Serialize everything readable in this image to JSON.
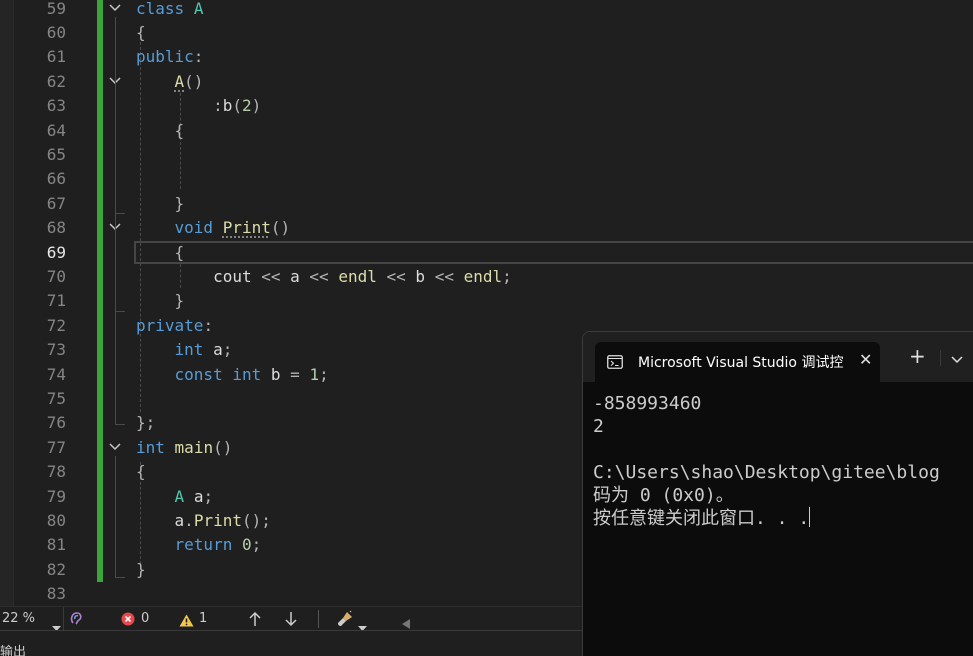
{
  "editor": {
    "line_numbers": [
      "59",
      "60",
      "61",
      "62",
      "63",
      "64",
      "65",
      "66",
      "67",
      "68",
      "69",
      "70",
      "71",
      "72",
      "73",
      "74",
      "75",
      "76",
      "77",
      "78",
      "79",
      "80",
      "81",
      "82",
      "83"
    ],
    "current_line": "69",
    "code": {
      "l59": {
        "kw": "class",
        "name": "A"
      },
      "l60": {
        "p": "{"
      },
      "l61": {
        "kw": "public",
        "p": ":"
      },
      "l62": {
        "name": "A",
        "p": "()"
      },
      "l63": {
        "a": ":",
        "b": "b",
        "c": "(",
        "n": "2",
        "d": ")"
      },
      "l64": {
        "p": "{"
      },
      "l67": {
        "p": "}"
      },
      "l68": {
        "kw": "void",
        "fn": "Print",
        "p": "()"
      },
      "l69": {
        "p": "{"
      },
      "l70": {
        "a": "cout",
        "b": "<<",
        "c": "a",
        "d": "<<",
        "e": "endl",
        "f": "<<",
        "g": "b",
        "h": "<<",
        "i": "endl",
        "j": ";"
      },
      "l71": {
        "p": "}"
      },
      "l72": {
        "kw": "private",
        "p": ":"
      },
      "l73": {
        "kw": "int",
        "id": "a",
        "p": ";"
      },
      "l74": {
        "kw1": "const",
        "kw2": "int",
        "id": "b",
        "eq": "=",
        "n": "1",
        "p": ";"
      },
      "l76": {
        "p": "};"
      },
      "l77": {
        "kw": "int",
        "fn": "main",
        "p": "()"
      },
      "l78": {
        "p": "{"
      },
      "l79": {
        "ty": "A",
        "id": "a",
        "p": ";"
      },
      "l80": {
        "id": "a",
        "dot": ".",
        "fn": "Print",
        "p": "();"
      },
      "l81": {
        "kw": "return",
        "n": "0",
        "p": ";"
      },
      "l82": {
        "p": "}"
      }
    }
  },
  "statusbar": {
    "zoom": "22 %",
    "errors": "0",
    "warnings": "1"
  },
  "output_label": "输出",
  "console": {
    "tab_title": "Microsoft Visual Studio 调试控",
    "close_glyph": "✕",
    "new_tab_glyph": "+",
    "lines": [
      "-858993460",
      "2",
      "",
      "C:\\Users\\shao\\Desktop\\gitee\\blog",
      "码为 0 (0x0)。",
      "按任意键关闭此窗口. . ."
    ]
  },
  "colors": {
    "editor_bg": "#1f1f1f",
    "keyword": "#569cd6",
    "type": "#4ec9b0",
    "function": "#dcdcaa",
    "number": "#b5cea8",
    "change_bar": "#3da53d",
    "console_bg": "#0c0c0c"
  },
  "icons": [
    "chevron-down-icon",
    "error-icon",
    "warning-icon",
    "arrow-up-icon",
    "arrow-down-icon",
    "brush-icon",
    "terminal-icon",
    "close-icon",
    "plus-icon"
  ]
}
